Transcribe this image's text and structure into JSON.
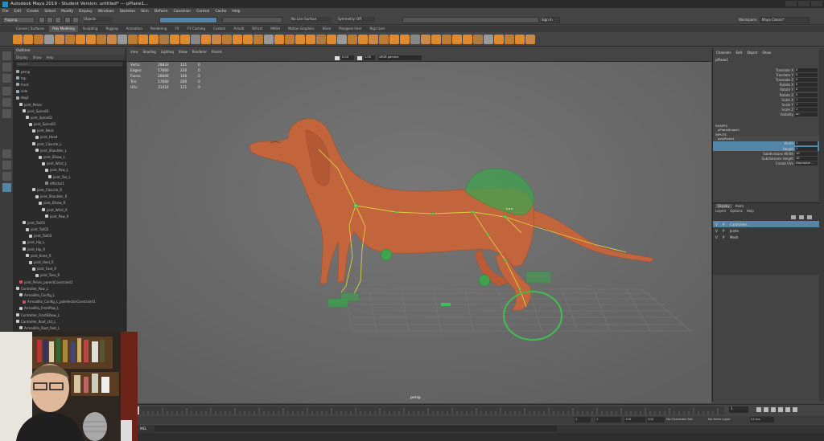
{
  "window": {
    "title": "Autodesk Maya 2019 - Student Version: untitled*  ---  pPlane1..."
  },
  "menubar": {
    "items": [
      "File",
      "Edit",
      "Create",
      "Select",
      "Modify",
      "Display",
      "Windows",
      "Skeleton",
      "Skin",
      "Deform",
      "Constrain",
      "Control",
      "Cache",
      "Help"
    ]
  },
  "statusline": {
    "menuset": "Rigging",
    "objects_label": "Objects",
    "live_surface": "No Live Surface",
    "symmetry": "Symmetry: Off",
    "sign_in": "Sign In",
    "workspace_label": "Workspace:",
    "workspace_value": "Maya Classic*"
  },
  "shelf_tabs": [
    "Curves / Surfaces",
    "Poly Modeling",
    "Sculpting",
    "Rigging",
    "Animation",
    "Rendering",
    "FX",
    "FX Caching",
    "Custom",
    "Arnold",
    "Bifrost",
    "MASH",
    "Motion Graphics",
    "XGen",
    "Polygons User",
    "Rigs User"
  ],
  "shelf_active_tab": "Poly Modeling",
  "outliner": {
    "title": "Outliner",
    "menus": [
      "Display",
      "Show",
      "Help"
    ],
    "search_placeholder": "Search...",
    "rows": [
      {
        "label": "persp",
        "depth": 0,
        "type": "camera"
      },
      {
        "label": "top",
        "depth": 0,
        "type": "camera"
      },
      {
        "label": "front",
        "depth": 0,
        "type": "camera"
      },
      {
        "label": "side",
        "depth": 0,
        "type": "camera"
      },
      {
        "label": "dog1",
        "depth": 0,
        "type": "mesh"
      },
      {
        "label": "joint_Pelvis",
        "depth": 1,
        "type": "joint"
      },
      {
        "label": "joint_Spine01",
        "depth": 2,
        "type": "joint"
      },
      {
        "label": "joint_Spine02",
        "depth": 3,
        "type": "joint"
      },
      {
        "label": "joint_Spine03",
        "depth": 4,
        "type": "joint"
      },
      {
        "label": "joint_Neck",
        "depth": 5,
        "type": "joint"
      },
      {
        "label": "joint_Head",
        "depth": 6,
        "type": "joint"
      },
      {
        "label": "joint_Clavicle_L",
        "depth": 5,
        "type": "joint"
      },
      {
        "label": "joint_Shoulder_L",
        "depth": 6,
        "type": "joint"
      },
      {
        "label": "joint_Elbow_L",
        "depth": 7,
        "type": "joint"
      },
      {
        "label": "joint_Wrist_L",
        "depth": 8,
        "type": "joint"
      },
      {
        "label": "joint_Paw_L",
        "depth": 9,
        "type": "joint"
      },
      {
        "label": "joint_Toe_L",
        "depth": 10,
        "type": "joint"
      },
      {
        "label": "effector1",
        "depth": 9,
        "type": "effector"
      },
      {
        "label": "joint_Clavicle_R",
        "depth": 5,
        "type": "joint"
      },
      {
        "label": "joint_Shoulder_R",
        "depth": 6,
        "type": "joint"
      },
      {
        "label": "joint_Elbow_R",
        "depth": 7,
        "type": "joint"
      },
      {
        "label": "joint_Wrist_R",
        "depth": 8,
        "type": "joint"
      },
      {
        "label": "joint_Paw_R",
        "depth": 9,
        "type": "joint"
      },
      {
        "label": "joint_Tail01",
        "depth": 2,
        "type": "joint"
      },
      {
        "label": "joint_Tail02",
        "depth": 3,
        "type": "joint"
      },
      {
        "label": "joint_Tail03",
        "depth": 4,
        "type": "joint"
      },
      {
        "label": "joint_Hip_L",
        "depth": 2,
        "type": "joint"
      },
      {
        "label": "joint_Hip_R",
        "depth": 2,
        "type": "joint"
      },
      {
        "label": "joint_Knee_R",
        "depth": 3,
        "type": "joint"
      },
      {
        "label": "joint_Heel_R",
        "depth": 4,
        "type": "joint"
      },
      {
        "label": "joint_Foot_R",
        "depth": 5,
        "type": "joint"
      },
      {
        "label": "joint_Toes_R",
        "depth": 6,
        "type": "joint"
      },
      {
        "label": "joint_Pelvis_parentConstraint1",
        "depth": 1,
        "type": "constraint"
      },
      {
        "label": "Controller_Paw_L",
        "depth": 0,
        "type": "curve"
      },
      {
        "label": "Armadillo_Config_L",
        "depth": 1,
        "type": "curve"
      },
      {
        "label": "Armadillo_Config_L_poleVectorConstraint1",
        "depth": 2,
        "type": "constraint"
      },
      {
        "label": "Armadillo_FrontPaw_L",
        "depth": 1,
        "type": "curve"
      },
      {
        "label": "Controller_FrontElbow_L",
        "depth": 0,
        "type": "curve"
      },
      {
        "label": "Controller_Root_ctrl_L",
        "depth": 0,
        "type": "curve"
      },
      {
        "label": "Armadillo_Root_feet_L",
        "depth": 1,
        "type": "curve"
      }
    ]
  },
  "viewport": {
    "menus": [
      "View",
      "Shading",
      "Lighting",
      "Show",
      "Renderer",
      "Panels"
    ],
    "exposure": "0.00",
    "gamma": "1.00",
    "color_space": "sRGB gamma",
    "camera_label": "persp",
    "stats": [
      {
        "label": "Verts:",
        "a": "28833",
        "b": "121",
        "c": "0"
      },
      {
        "label": "Edges:",
        "a": "57660",
        "b": "220",
        "c": "0"
      },
      {
        "label": "Faces:",
        "a": "28840",
        "b": "100",
        "c": "0"
      },
      {
        "label": "Tris:",
        "a": "57660",
        "b": "200",
        "c": "0"
      },
      {
        "label": "UVs:",
        "a": "31416",
        "b": "121",
        "c": "0"
      }
    ]
  },
  "channel_box": {
    "menus": [
      "Channels",
      "Edit",
      "Object",
      "Show"
    ],
    "object_name": "pPlane1",
    "channels": [
      {
        "name": "Translate X",
        "value": "0"
      },
      {
        "name": "Translate Y",
        "value": "0"
      },
      {
        "name": "Translate Z",
        "value": "0"
      },
      {
        "name": "Rotate X",
        "value": "0"
      },
      {
        "name": "Rotate Y",
        "value": "0"
      },
      {
        "name": "Rotate Z",
        "value": "0"
      },
      {
        "name": "Scale X",
        "value": "1"
      },
      {
        "name": "Scale Y",
        "value": "1"
      },
      {
        "name": "Scale Z",
        "value": "1"
      },
      {
        "name": "Visibility",
        "value": "on"
      }
    ],
    "shapes_label": "SHAPES",
    "shape_name": "pPlaneShape1",
    "inputs_label": "INPUTS",
    "input_name": "polyPlane1",
    "input_channels": [
      {
        "name": "Width",
        "value": "1"
      },
      {
        "name": "Height",
        "value": "1"
      },
      {
        "name": "Subdivisions Width",
        "value": "10"
      },
      {
        "name": "Subdivisions Height",
        "value": "10"
      },
      {
        "name": "Create UVs",
        "value": "Normalize ..."
      }
    ]
  },
  "layer_editor": {
    "tabs": [
      "Display",
      "Anim"
    ],
    "menus": [
      "Layers",
      "Options",
      "Help"
    ],
    "layers": [
      {
        "v": "V",
        "p": "P",
        "name": "Controllers",
        "selected": true
      },
      {
        "v": "V",
        "p": "P",
        "name": "Joints",
        "selected": false
      },
      {
        "v": "V",
        "p": "P",
        "name": "Mesh",
        "selected": false
      }
    ]
  },
  "range": {
    "start": "1",
    "inner_start": "1",
    "inner_end": "120",
    "end": "120",
    "end2": "200",
    "current_frame": "1",
    "character_set": "No Character Set",
    "anim_layer": "No Anim Layer",
    "fps": "24 fps"
  },
  "command_line": {
    "lang": "MEL"
  },
  "colors": {
    "dog": "#c2643c",
    "ctrl_green": "#3fbf4f",
    "joint_yellow": "#d9d040",
    "selection_blue": "#5285a6"
  }
}
